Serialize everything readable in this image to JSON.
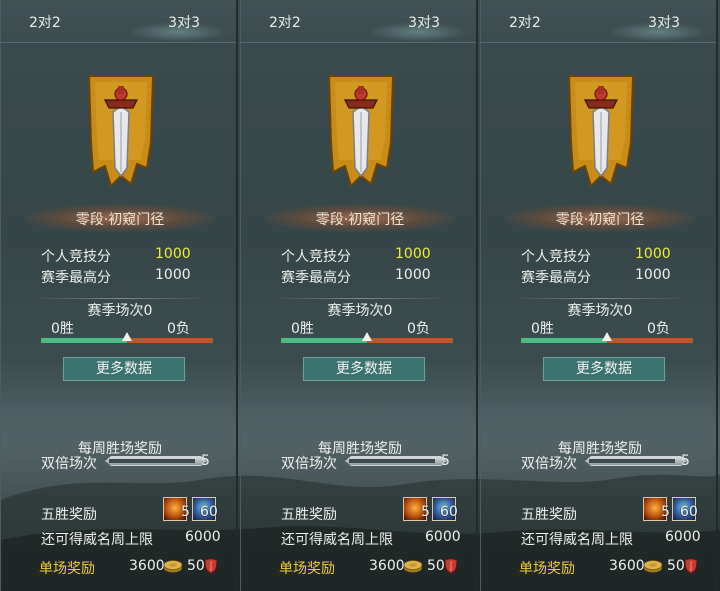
{
  "panels": [
    {
      "tabs": {
        "left": "2对2",
        "right": "3对3"
      },
      "rank_title": "零段·初窥门径",
      "personal_score_label": "个人竞技分",
      "personal_score_value": "1000",
      "season_best_label": "赛季最高分",
      "season_best_value": "1000",
      "season_matches": "赛季场次0",
      "wins": "0胜",
      "losses": "0负",
      "win_ratio": 0.5,
      "more_button": "更多数据",
      "weekly_title": "每周胜场奖励",
      "double_label": "双倍场次",
      "double_count": "5",
      "five_win_label": "五胜奖励",
      "item1_count": "5",
      "item2_count": "60",
      "weekly_cap_label": "还可得威名周上限",
      "weekly_cap_value": "6000",
      "single_reward_label": "单场奖励",
      "coin_value": "3600",
      "shield_value": "50"
    },
    {
      "tabs": {
        "left": "2对2",
        "right": "3对3"
      },
      "rank_title": "零段·初窥门径",
      "personal_score_label": "个人竞技分",
      "personal_score_value": "1000",
      "season_best_label": "赛季最高分",
      "season_best_value": "1000",
      "season_matches": "赛季场次0",
      "wins": "0胜",
      "losses": "0负",
      "win_ratio": 0.5,
      "more_button": "更多数据",
      "weekly_title": "每周胜场奖励",
      "double_label": "双倍场次",
      "double_count": "5",
      "five_win_label": "五胜奖励",
      "item1_count": "5",
      "item2_count": "60",
      "weekly_cap_label": "还可得威名周上限",
      "weekly_cap_value": "6000",
      "single_reward_label": "单场奖励",
      "coin_value": "3600",
      "shield_value": "50"
    },
    {
      "tabs": {
        "left": "2对2",
        "right": "3对3"
      },
      "rank_title": "零段·初窥门径",
      "personal_score_label": "个人竞技分",
      "personal_score_value": "1000",
      "season_best_label": "赛季最高分",
      "season_best_value": "1000",
      "season_matches": "赛季场次0",
      "wins": "0胜",
      "losses": "0负",
      "win_ratio": 0.5,
      "more_button": "更多数据",
      "weekly_title": "每周胜场奖励",
      "double_label": "双倍场次",
      "double_count": "5",
      "five_win_label": "五胜奖励",
      "item1_count": "5",
      "item2_count": "60",
      "weekly_cap_label": "还可得威名周上限",
      "weekly_cap_value": "6000",
      "single_reward_label": "单场奖励",
      "coin_value": "3600",
      "shield_value": "50"
    }
  ],
  "colors": {
    "score_yellow": "#f0ea35",
    "gold_label": "#f0cc32",
    "win_green": "#4cbb86",
    "loss_orange": "#b4592c",
    "button_teal": "#3c7370"
  },
  "icons": {
    "emblem": "sword-banner-emblem-icon",
    "item1": "fire-scroll-icon",
    "item2": "blue-key-icon",
    "coin": "coin-icon",
    "shield": "shield-icon"
  }
}
